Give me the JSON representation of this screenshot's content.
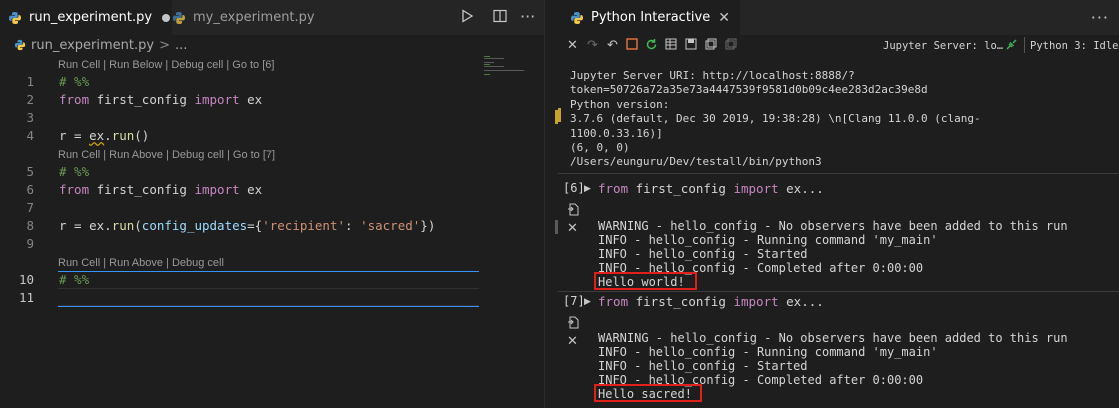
{
  "editor": {
    "tabs": [
      {
        "label": "run_experiment.py",
        "modified": true
      },
      {
        "label": "my_experiment.py",
        "modified": false
      }
    ],
    "breadcrumb": {
      "file": "run_experiment.py",
      "sep": ">",
      "rest": "..."
    },
    "code_lens": [
      "Run Cell | Run Below | Debug cell | Go to [6]",
      "Run Cell | Run Above | Debug cell | Go to [7]",
      "Run Cell | Run Above | Debug cell"
    ],
    "lines": [
      {
        "n": "1",
        "text": "# %%"
      },
      {
        "n": "2",
        "text": "from first_config import ex"
      },
      {
        "n": "3",
        "text": ""
      },
      {
        "n": "4",
        "text": "r = ex.run()"
      },
      {
        "n": "5",
        "text": "# %%"
      },
      {
        "n": "6",
        "text": "from first_config import ex"
      },
      {
        "n": "7",
        "text": ""
      },
      {
        "n": "8",
        "text": "r = ex.run(config_updates={'recipient': 'sacred'})"
      },
      {
        "n": "9",
        "text": ""
      },
      {
        "n": "10",
        "text": "# %%"
      },
      {
        "n": "11",
        "text": ""
      }
    ]
  },
  "interactive": {
    "tab_label": "Python Interactive",
    "jupyter_server": "Jupyter Server: lo…",
    "kernel": "Python 3: Idle",
    "sysinfo": [
      "Jupyter Server URI: http://localhost:8888/?",
      "token=50726a72a35e73a4447539f9581d0b09c4ee283d2ac39e8d",
      "Python version:",
      "3.7.6 (default, Dec 30 2019, 19:38:28) \\n[Clang 11.0.0 (clang-",
      "1100.0.33.16)]",
      "(6, 0, 0)",
      "/Users/eunguru/Dev/testall/bin/python3"
    ],
    "cells": [
      {
        "exec": "[6]",
        "input_kw1": "from",
        "input_mod": " first_config ",
        "input_kw2": "import",
        "input_rest": " ex...",
        "output": [
          "WARNING - hello_config - No observers have been added to this run",
          "INFO - hello_config - Running command 'my_main'",
          "INFO - hello_config - Started",
          "INFO - hello_config - Completed after 0:00:00"
        ],
        "result": "Hello world!"
      },
      {
        "exec": "[7]",
        "input_kw1": "from",
        "input_mod": " first_config ",
        "input_kw2": "import",
        "input_rest": " ex...",
        "output": [
          "WARNING - hello_config - No observers have been added to this run",
          "INFO - hello_config - Running command 'my_main'",
          "INFO - hello_config - Started",
          "INFO - hello_config - Completed after 0:00:00"
        ],
        "result": "Hello sacred!"
      }
    ]
  },
  "colors": {
    "highlight": "#e0201b",
    "accent": "#3794ff",
    "keyword": "#c586c0",
    "comment": "#6a9955"
  }
}
